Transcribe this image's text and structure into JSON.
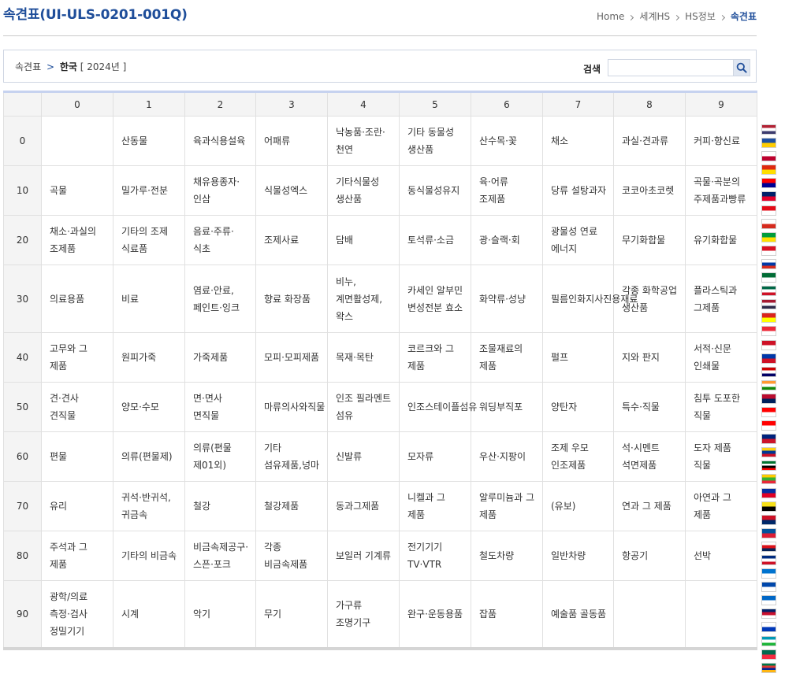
{
  "header": {
    "page_title": "속견표(UI-ULS-0201-001Q)",
    "breadcrumb": [
      "Home",
      "세계HS",
      "HS정보",
      "속견표"
    ]
  },
  "search": {
    "path_root": "속견표",
    "path_sep": ">",
    "country": "한국",
    "year": "[ 2024년 ]",
    "label": "검색",
    "value": "",
    "placeholder": ""
  },
  "table": {
    "columns": [
      "0",
      "1",
      "2",
      "3",
      "4",
      "5",
      "6",
      "7",
      "8",
      "9"
    ],
    "rows": [
      {
        "head": "0",
        "cells": [
          "",
          "산동물",
          "육과식용설육",
          "어패류",
          "낙농품·조란·천연",
          "기타 동물성 생산품",
          "산수목·꽃",
          "채소",
          "과실·견과류",
          "커피·향신료"
        ]
      },
      {
        "head": "10",
        "cells": [
          "곡물",
          "밀가루·전분",
          "채유용종자·인삼",
          "식물성엑스",
          "기타식물성 생산품",
          "동식물성유지",
          "육·어류 조제품",
          "당류 설탕과자",
          "코코아초코렛",
          "곡물·곡분의 주제품과빵류"
        ]
      },
      {
        "head": "20",
        "cells": [
          "채소·과실의 조제품",
          "기타의 조제 식료품",
          "음료·주류·식초",
          "조제사료",
          "담배",
          "토석류·소금",
          "광·슬랙·회",
          "광물성 연료 에너지",
          "무기화합물",
          "유기화합물"
        ]
      },
      {
        "head": "30",
        "cells": [
          "의료용품",
          "비료",
          "염료·안료,페인트·잉크",
          "향료 화장품",
          "비누, 계면활성제, 왁스",
          "카세인 알부민 변성전분 효소",
          "화약류·성냥",
          "필름인화지사진용재료",
          "각종 화학공업 생산품",
          "플라스틱과 그제품"
        ]
      },
      {
        "head": "40",
        "cells": [
          "고무와 그 제품",
          "원피가죽",
          "가죽제품",
          "모피·모피제품",
          "목재·목탄",
          "코르크와 그 제품",
          "조물재료의 제품",
          "펄프",
          "지와 판지",
          "서적·신문 인쇄물"
        ]
      },
      {
        "head": "50",
        "cells": [
          "견·견사 견직물",
          "양모·수모",
          "면·면사 면직물",
          "마류의사와직물",
          "인조 필라멘트 섬유",
          "인조스테이플섬유",
          "워딩부직포",
          "양탄자",
          "특수·직물",
          "침투 도포한 직물"
        ]
      },
      {
        "head": "60",
        "cells": [
          "편물",
          "의류(편물제)",
          "의류(편물 제01외)",
          "기타 섬유제품,넝마",
          "신발류",
          "모자류",
          "우산·지팡이",
          "조제 우모 인조제품",
          "석·시멘트 석면제품",
          "도자 제품 직물"
        ]
      },
      {
        "head": "70",
        "cells": [
          "유리",
          "귀석·반귀석, 귀금속",
          "철강",
          "철강제품",
          "동과그제품",
          "니켈과 그 제품",
          "알루미늄과 그 제품",
          "(유보)",
          "연과 그 제품",
          "아연과 그 제품"
        ]
      },
      {
        "head": "80",
        "cells": [
          "주석과 그 제품",
          "기타의 비금속",
          "비금속제공구·스픈·포크",
          "각종 비금속제품",
          "보일러 기계류",
          "전기기기 TV·VTR",
          "철도차량",
          "일반차량",
          "항공기",
          "선박"
        ]
      },
      {
        "head": "90",
        "cells": [
          "광학/의료 측정·검사 정밀기기",
          "시계",
          "악기",
          "무기",
          "가구류 조명기구",
          "완구·운동용품",
          "잡품",
          "예술품 골동품",
          "",
          ""
        ]
      }
    ]
  },
  "flags": [
    {
      "name": "us",
      "colors": [
        "#b22234",
        "#ffffff",
        "#3c3b6e"
      ]
    },
    {
      "name": "eu",
      "colors": [
        "#1e4fa0",
        "#ffcc00"
      ]
    },
    {
      "name": "japan",
      "colors": [
        "#ffffff",
        "#bc002d"
      ]
    },
    {
      "name": "china",
      "colors": [
        "#de2910",
        "#ffde00"
      ]
    },
    {
      "name": "taiwan",
      "colors": [
        "#fe0000",
        "#000095"
      ]
    },
    {
      "name": "australia",
      "colors": [
        "#012169",
        "#e4002b"
      ]
    },
    {
      "name": "turkey",
      "colors": [
        "#e30a17",
        "#ffffff"
      ]
    },
    {
      "name": "chile",
      "colors": [
        "#ffffff",
        "#d52b1e"
      ]
    },
    {
      "name": "brazil",
      "colors": [
        "#009c3b",
        "#ffdf00"
      ]
    },
    {
      "name": "peru",
      "colors": [
        "#d91023",
        "#ffffff"
      ]
    },
    {
      "name": "russia",
      "colors": [
        "#ffffff",
        "#0039a6",
        "#d52b1e"
      ]
    },
    {
      "name": "saudi",
      "colors": [
        "#006c35",
        "#ffffff"
      ]
    },
    {
      "name": "mexico",
      "colors": [
        "#006847",
        "#ffffff",
        "#ce1126"
      ]
    },
    {
      "name": "thailand",
      "colors": [
        "#a51931",
        "#f4f5f8",
        "#2d2a4a"
      ]
    },
    {
      "name": "vietnam",
      "colors": [
        "#da251d",
        "#ffff00"
      ]
    },
    {
      "name": "singapore",
      "colors": [
        "#ed2939",
        "#ffffff"
      ]
    },
    {
      "name": "indonesia",
      "colors": [
        "#ce1126",
        "#ffffff"
      ]
    },
    {
      "name": "philippines",
      "colors": [
        "#0038a8",
        "#ce1126"
      ]
    },
    {
      "name": "malaysia",
      "colors": [
        "#cc0001",
        "#ffffff",
        "#010066"
      ]
    },
    {
      "name": "india",
      "colors": [
        "#ff9933",
        "#ffffff",
        "#138808"
      ]
    },
    {
      "name": "norway",
      "colors": [
        "#ba0c2f",
        "#00205b"
      ]
    },
    {
      "name": "switzerland",
      "colors": [
        "#ff0000",
        "#ffffff"
      ]
    },
    {
      "name": "canada",
      "colors": [
        "#ff0000",
        "#ffffff"
      ]
    },
    {
      "name": "new-zealand",
      "colors": [
        "#00247d",
        "#cc142b"
      ]
    },
    {
      "name": "colombia",
      "colors": [
        "#fcd116",
        "#003893",
        "#ce1126"
      ]
    },
    {
      "name": "uae",
      "colors": [
        "#00732f",
        "#ffffff",
        "#000000",
        "#ff0000"
      ]
    },
    {
      "name": "myanmar",
      "colors": [
        "#fecb00",
        "#34b233",
        "#ea2839"
      ]
    },
    {
      "name": "cambodia",
      "colors": [
        "#032ea1",
        "#e00025"
      ]
    },
    {
      "name": "brunei",
      "colors": [
        "#f7e017",
        "#000000"
      ]
    },
    {
      "name": "laos",
      "colors": [
        "#ce1126",
        "#002868"
      ]
    },
    {
      "name": "iceland",
      "colors": [
        "#02529c",
        "#dc1e35"
      ]
    },
    {
      "name": "panama",
      "colors": [
        "#ffffff",
        "#da121a",
        "#072357"
      ]
    },
    {
      "name": "costa-rica",
      "colors": [
        "#002b7f",
        "#ffffff",
        "#ce1126"
      ]
    },
    {
      "name": "honduras",
      "colors": [
        "#0073cf",
        "#ffffff"
      ]
    },
    {
      "name": "el-salvador",
      "colors": [
        "#0047ab",
        "#ffffff"
      ]
    },
    {
      "name": "nicaragua",
      "colors": [
        "#0067c6",
        "#ffffff"
      ]
    },
    {
      "name": "uk",
      "colors": [
        "#012169",
        "#c8102e",
        "#ffffff"
      ]
    },
    {
      "name": "israel",
      "colors": [
        "#ffffff",
        "#0038b8"
      ]
    },
    {
      "name": "uzbekistan",
      "colors": [
        "#0099b5",
        "#ffffff",
        "#1eb53a"
      ]
    },
    {
      "name": "bangladesh",
      "colors": [
        "#006a4e",
        "#f42a41"
      ]
    },
    {
      "name": "south-africa",
      "colors": [
        "#007749",
        "#de3831",
        "#002395",
        "#ffb612"
      ]
    }
  ]
}
